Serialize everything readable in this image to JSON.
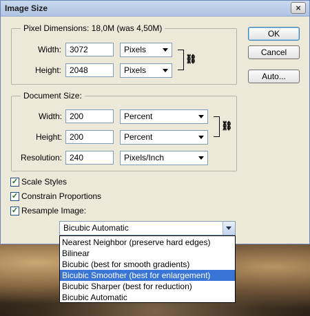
{
  "window": {
    "title": "Image Size",
    "close_glyph": "×"
  },
  "pixel_dimensions": {
    "legend": "Pixel Dimensions:",
    "summary": "18,0M (was 4,50M)",
    "width_label": "Width:",
    "width_value": "3072",
    "width_unit": "Pixels",
    "height_label": "Height:",
    "height_value": "2048",
    "height_unit": "Pixels"
  },
  "document_size": {
    "legend": "Document Size:",
    "width_label": "Width:",
    "width_value": "200",
    "width_unit": "Percent",
    "height_label": "Height:",
    "height_value": "200",
    "height_unit": "Percent",
    "resolution_label": "Resolution:",
    "resolution_value": "240",
    "resolution_unit": "Pixels/Inch"
  },
  "buttons": {
    "ok": "OK",
    "cancel": "Cancel",
    "auto": "Auto..."
  },
  "checkboxes": [
    {
      "label": "Scale Styles",
      "checked": true
    },
    {
      "label": "Constrain Proportions",
      "checked": true
    },
    {
      "label": "Resample Image:",
      "checked": true
    }
  ],
  "check_glyph": "✓",
  "link_glyph": "⛓",
  "resample": {
    "selected": "Bicubic Automatic",
    "options": [
      "Nearest Neighbor (preserve hard edges)",
      "Bilinear",
      "Bicubic (best for smooth gradients)",
      "Bicubic Smoother (best for enlargement)",
      "Bicubic Sharper (best for reduction)",
      "Bicubic Automatic"
    ],
    "highlighted_index": 3
  },
  "colors": {
    "highlight": "#3875d7",
    "dialog_bg": "#ece9d8",
    "titlebar": "#b0c4e3"
  }
}
